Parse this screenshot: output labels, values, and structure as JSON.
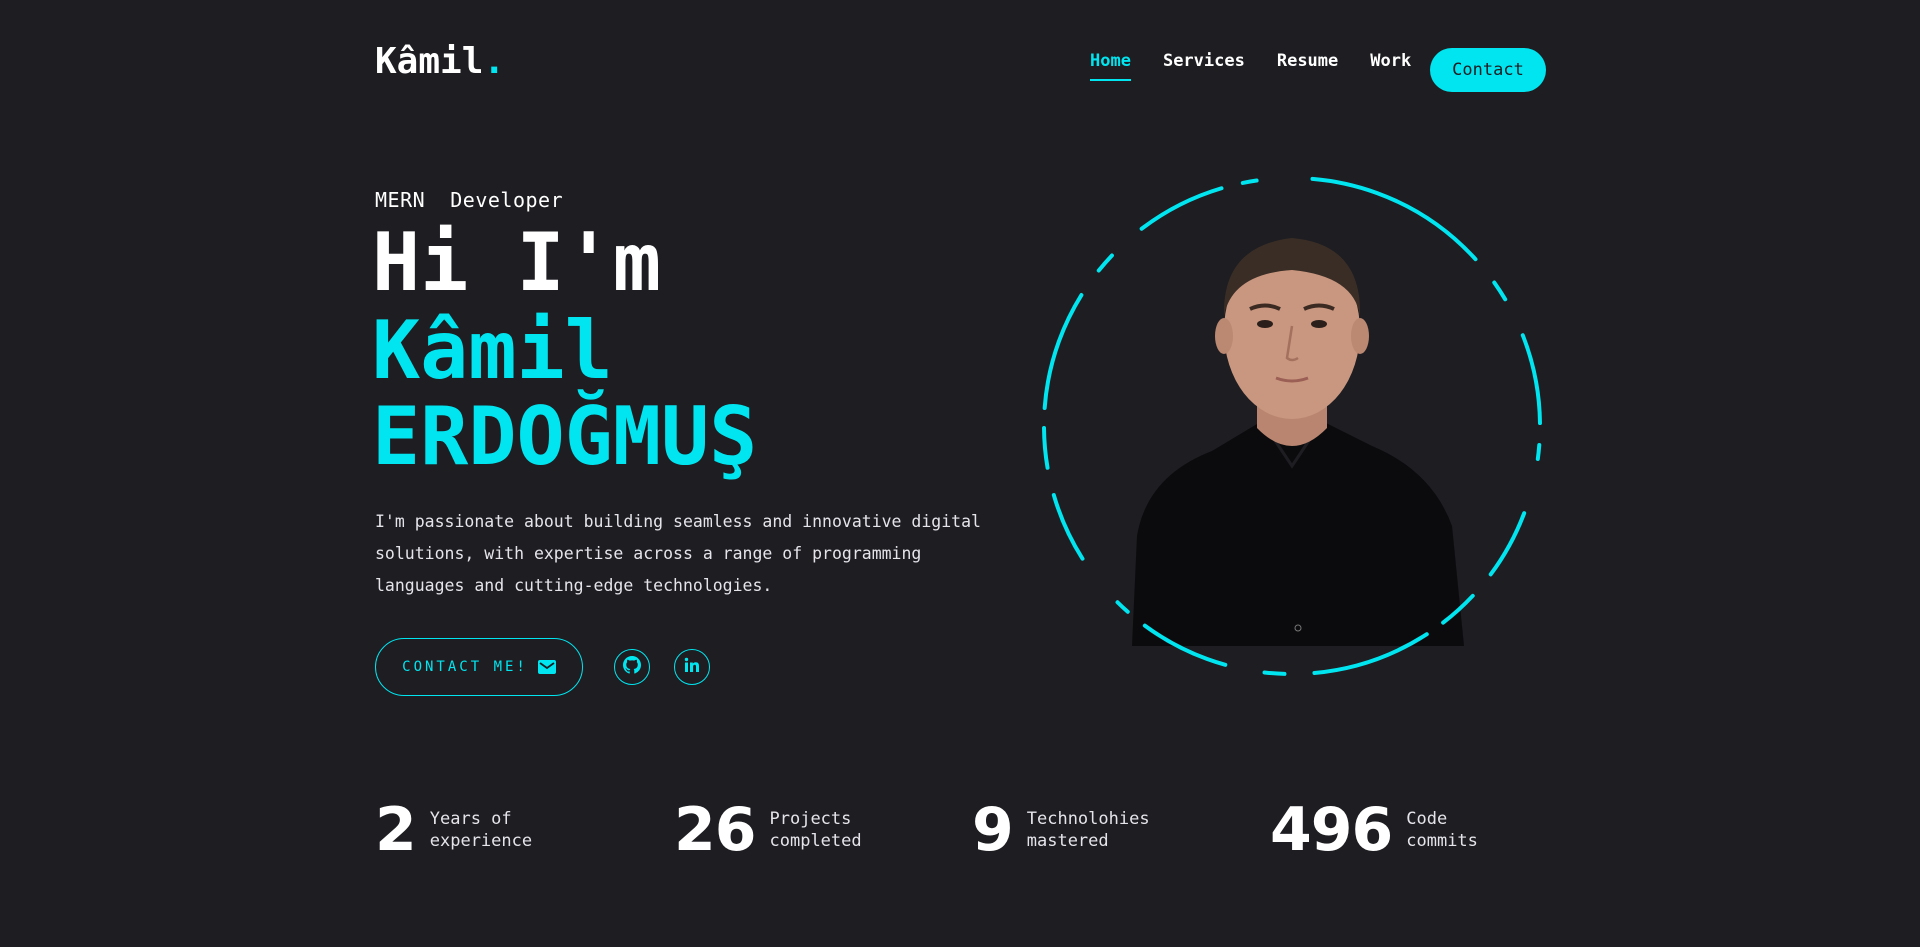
{
  "brand": {
    "name": "Kâmil",
    "dot": "."
  },
  "nav": {
    "items": [
      {
        "label": "Home",
        "active": true
      },
      {
        "label": "Services",
        "active": false
      },
      {
        "label": "Resume",
        "active": false
      },
      {
        "label": "Work",
        "active": false
      }
    ],
    "contact_label": "Contact"
  },
  "hero": {
    "role": "MERN  Developer",
    "greeting": "Hi I'm",
    "first_name": "Kâmil",
    "last_name": "ERDOĞMUŞ",
    "intro": "I'm passionate about building seamless and innovative digital solutions, with expertise across a range of programming languages and cutting-edge technologies.",
    "cta_label": "CONTACT ME!",
    "cta_icon": "mail-icon",
    "social": [
      {
        "name": "github-icon"
      },
      {
        "name": "linkedin-icon"
      }
    ]
  },
  "stats": [
    {
      "value": "2",
      "label_line1": "Years of",
      "label_line2": "experience"
    },
    {
      "value": "26",
      "label_line1": "Projects",
      "label_line2": "completed"
    },
    {
      "value": "9",
      "label_line1": "Technolohies",
      "label_line2": "mastered"
    },
    {
      "value": "496",
      "label_line1": "Code",
      "label_line2": "commits"
    }
  ],
  "colors": {
    "background": "#1d1d22",
    "accent": "#00e5ef",
    "text": "#ffffff"
  }
}
